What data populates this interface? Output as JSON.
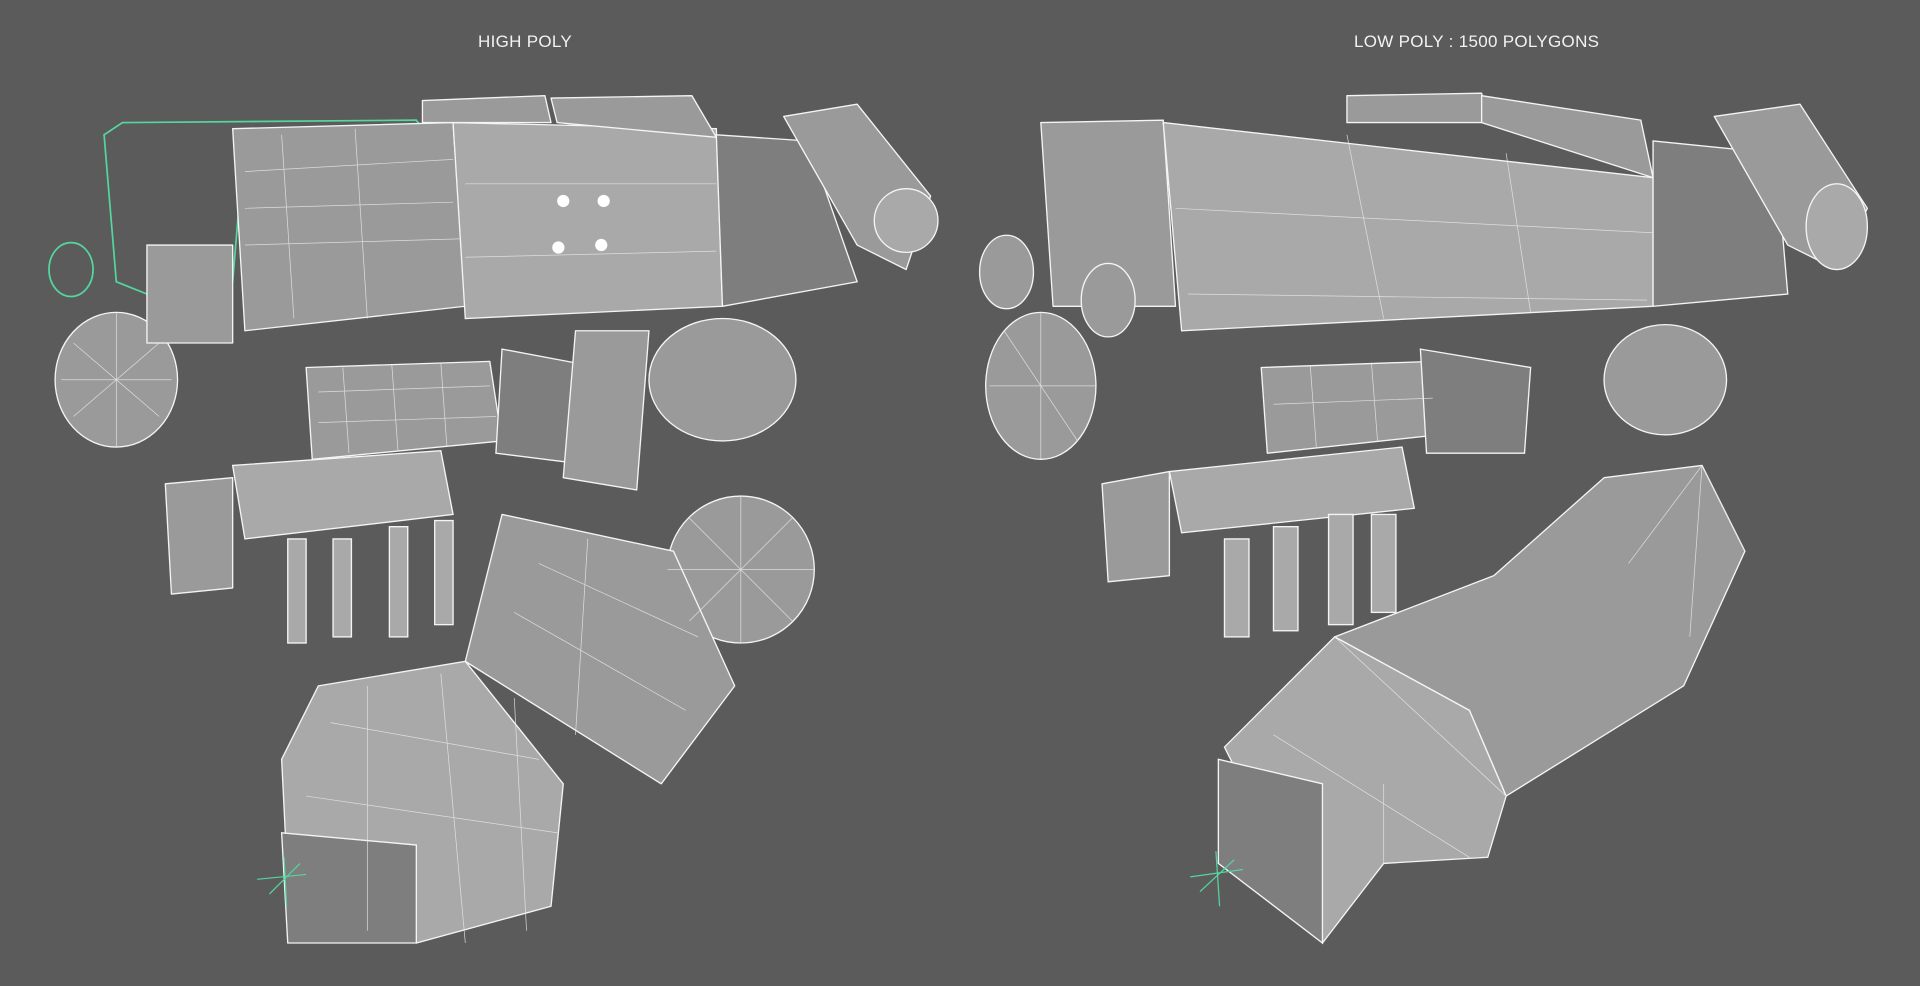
{
  "labels": {
    "high_poly": "HIGH POLY",
    "low_poly": "LOW POLY : 1500 POLYGONS"
  },
  "colors": {
    "background": "#5b5b5b",
    "wireframe": "#f4f4f4",
    "selection_outline": "#55d6a0"
  }
}
